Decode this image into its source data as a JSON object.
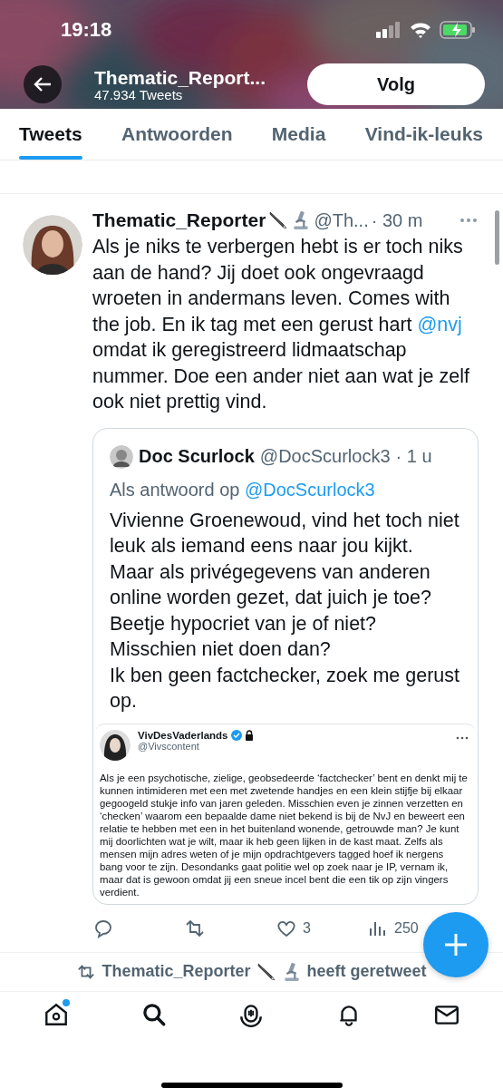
{
  "status_bar": {
    "time": "19:18"
  },
  "header": {
    "title": "Thematic_Report...",
    "subtitle": "47.934 Tweets",
    "follow_button": "Volg"
  },
  "tabs": [
    {
      "label": "Tweets",
      "selected": true
    },
    {
      "label": "Antwoorden",
      "selected": false
    },
    {
      "label": "Media",
      "selected": false
    },
    {
      "label": "Vind-ik-leuks",
      "selected": false
    }
  ],
  "tweet": {
    "author": "Thematic_Reporter",
    "handle": "@Th...",
    "time": "· 30 m",
    "text": [
      {
        "kind": "plain",
        "text": "Als je niks te verbergen hebt is er toch niks aan de hand? Jij doet ook ongevraagd wroeten in andermans leven. Comes with the job. En ik tag met een gerust hart "
      },
      {
        "kind": "mention",
        "text": "@nvj"
      },
      {
        "kind": "plain",
        "text": " omdat ik geregistreerd lidmaatschap nummer. Doe een ander niet aan wat je zelf ook niet prettig vind."
      }
    ],
    "quote": {
      "author": "Doc Scurlock",
      "handle": "@DocScurlock3",
      "time": "· 1 u",
      "reply_label": "Als antwoord op",
      "reply_to": "@DocScurlock3",
      "text": "Vivienne Groenewoud, vind het toch niet leuk als iemand eens naar jou kijkt.\nMaar als privégegevens van anderen online worden gezet, dat juich je toe?\nBeetje hypocriet van je of niet?\nMisschien niet doen dan?\nIk ben geen factchecker, zoek me gerust op.",
      "screenshot": {
        "author": "VivDesVaderlands",
        "handle": "@Vivscontent",
        "text": "Als je een psychotische, zielige, geobsedeerde ‘factchecker’ bent en denkt mij te kunnen intimideren met een met zwetende handjes en een klein stijfje bij elkaar gegoogeld stukje info van jaren geleden. Misschien even je zinnen verzetten en ‘checken’ waarom een bepaalde dame niet bekend is bij de NvJ en beweert een relatie te hebben met een in het buitenland wonende, getrouwde man? Je kunt mij doorlichten wat je wilt, maar ik heb geen lijken in de kast maat. Zelfs als mensen mijn adres weten of je mijn opdrachtgevers tagged hoef ik nergens bang voor te zijn. Desondanks gaat politie wel op zoek naar je IP, vernam ik, maar dat is gewoon omdat jij een sneue incel bent die een tik op zijn vingers verdient."
      }
    },
    "actions": [
      {
        "kind": "reply"
      },
      {
        "kind": "retweet"
      },
      {
        "kind": "like",
        "count": "3"
      },
      {
        "kind": "views",
        "count": "250"
      }
    ]
  },
  "retweet_banner": {
    "name": "Thematic_Reporter",
    "action": "heeft geretweet"
  },
  "nav": [
    {
      "kind": "home",
      "dot": true
    },
    {
      "kind": "search",
      "dot": false
    },
    {
      "kind": "spaces",
      "dot": false
    },
    {
      "kind": "notifications",
      "dot": false
    },
    {
      "kind": "messages",
      "dot": false
    }
  ]
}
